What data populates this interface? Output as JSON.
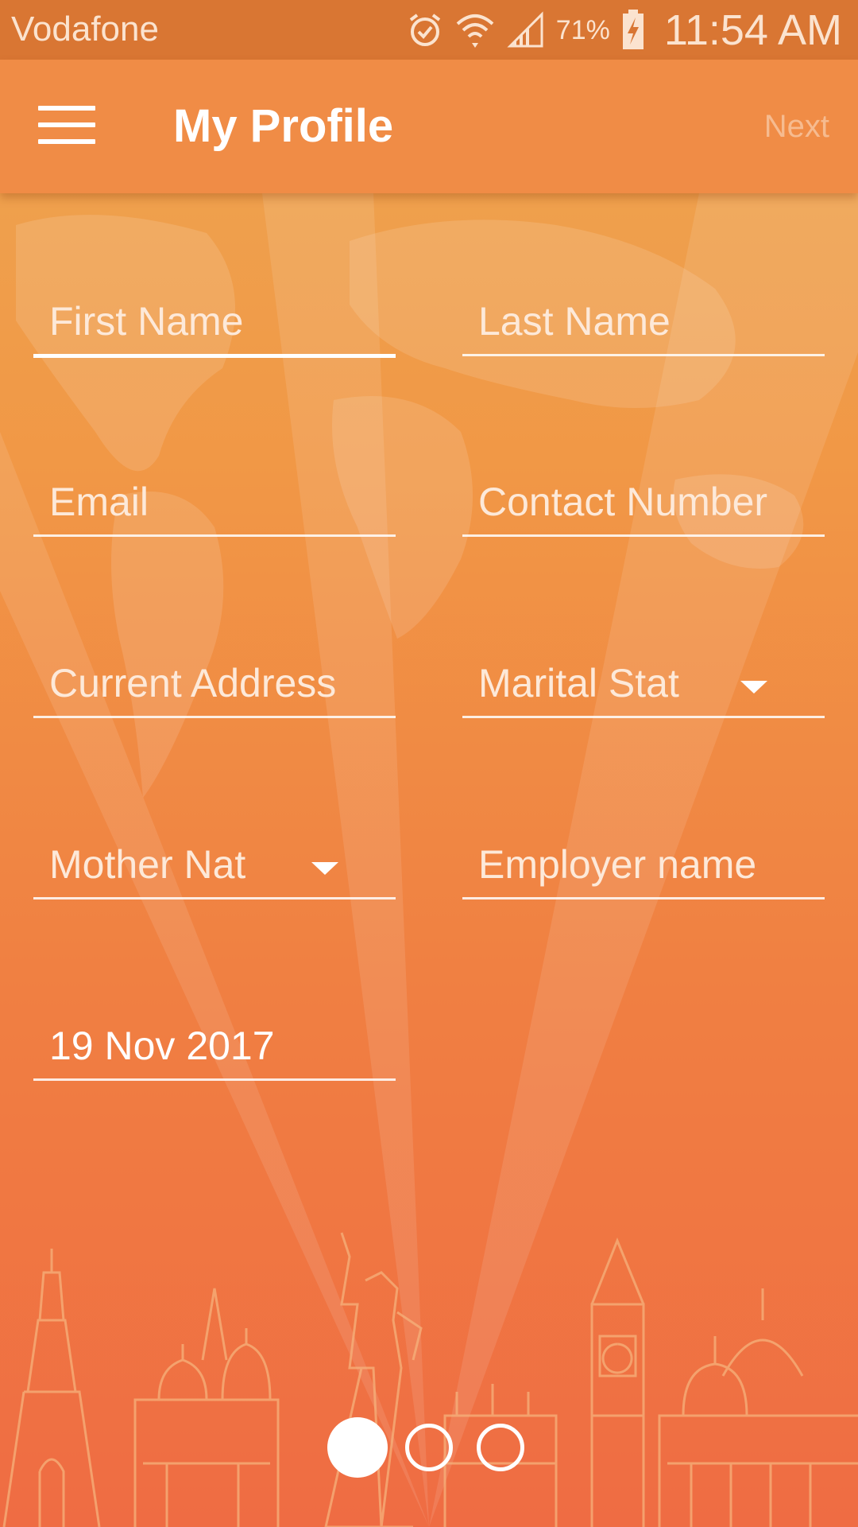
{
  "statusbar": {
    "carrier": "Vodafone",
    "battery_percent": "71%",
    "time": "11:54 AM",
    "icons": [
      "alarm-icon",
      "wifi-icon",
      "signal-icon",
      "battery-charging-icon"
    ]
  },
  "appbar": {
    "menu_icon": "hamburger-menu-icon",
    "title": "My Profile",
    "next_label": "Next"
  },
  "form": {
    "first_name_placeholder": "First Name",
    "last_name_placeholder": "Last Name",
    "email_placeholder": "Email",
    "contact_number_placeholder": "Contact Number",
    "current_address_placeholder": "Current Address",
    "marital_status_label": "Marital Stat",
    "mother_nationality_label": "Mother Nat",
    "employer_name_placeholder": "Employer name",
    "date_value": "19 Nov 2017"
  },
  "pager": {
    "pages": 3,
    "active_page": 1
  },
  "colors": {
    "status_bar": "#d97633",
    "app_bar": "#f08c46",
    "background_top": "#eda652",
    "background_bottom": "#ef6c43",
    "text": "#ffffff"
  }
}
